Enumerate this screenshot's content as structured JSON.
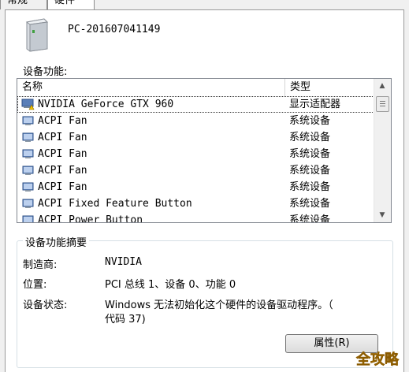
{
  "tabs": [
    {
      "label": "常规"
    },
    {
      "label": "硬件"
    }
  ],
  "device": {
    "name": "PC-201607041149"
  },
  "functions_label": "设备功能:",
  "list": {
    "columns": {
      "name": "名称",
      "type": "类型"
    },
    "rows": [
      {
        "name": "NVIDIA GeForce GTX 960",
        "type": "显示适配器",
        "warning": true,
        "selected": true
      },
      {
        "name": "ACPI Fan",
        "type": "系统设备"
      },
      {
        "name": "ACPI Fan",
        "type": "系统设备"
      },
      {
        "name": "ACPI Fan",
        "type": "系统设备"
      },
      {
        "name": "ACPI Fan",
        "type": "系统设备"
      },
      {
        "name": "ACPI Fan",
        "type": "系统设备"
      },
      {
        "name": "ACPI Fixed Feature Button",
        "type": "系统设备"
      },
      {
        "name": "ACPI Power Button",
        "type": "系统设备"
      }
    ]
  },
  "summary": {
    "title": "设备功能摘要",
    "manufacturer_label": "制造商:",
    "manufacturer": "NVIDIA",
    "location_label": "位置:",
    "location": "PCI 总线 1、设备 0、功能 0",
    "status_label": "设备状态:",
    "status_line1": "Windows 无法初始化这个硬件的设备驱动程序。（",
    "status_line2": "代码 37)"
  },
  "properties_button": "属性(R)",
  "watermark": "全攻略"
}
